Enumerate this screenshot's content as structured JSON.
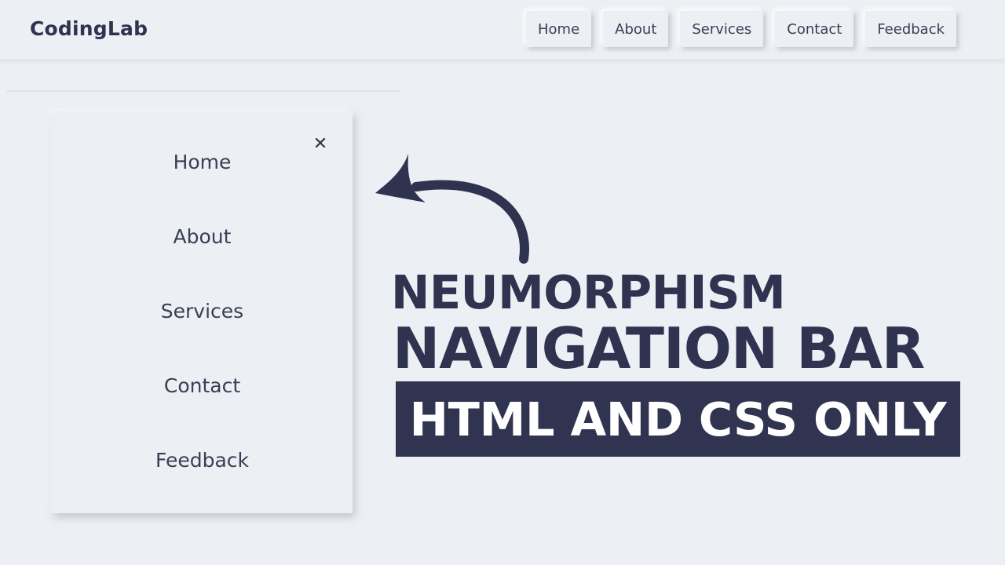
{
  "header": {
    "logo": "CodingLab",
    "nav": [
      {
        "label": "Home"
      },
      {
        "label": "About"
      },
      {
        "label": "Services"
      },
      {
        "label": "Contact"
      },
      {
        "label": "Feedback"
      }
    ]
  },
  "drawer": {
    "close_icon": "close-icon",
    "items": [
      {
        "label": "Home"
      },
      {
        "label": "About"
      },
      {
        "label": "Services"
      },
      {
        "label": "Contact"
      },
      {
        "label": "Feedback"
      }
    ]
  },
  "headline": {
    "line1": "NEUMORPHISM",
    "line2": "NAVIGATION BAR",
    "banner": "HTML AND CSS ONLY"
  },
  "colors": {
    "background": "#eceff3",
    "accent": "#303450",
    "banner_text": "#ffffff"
  }
}
